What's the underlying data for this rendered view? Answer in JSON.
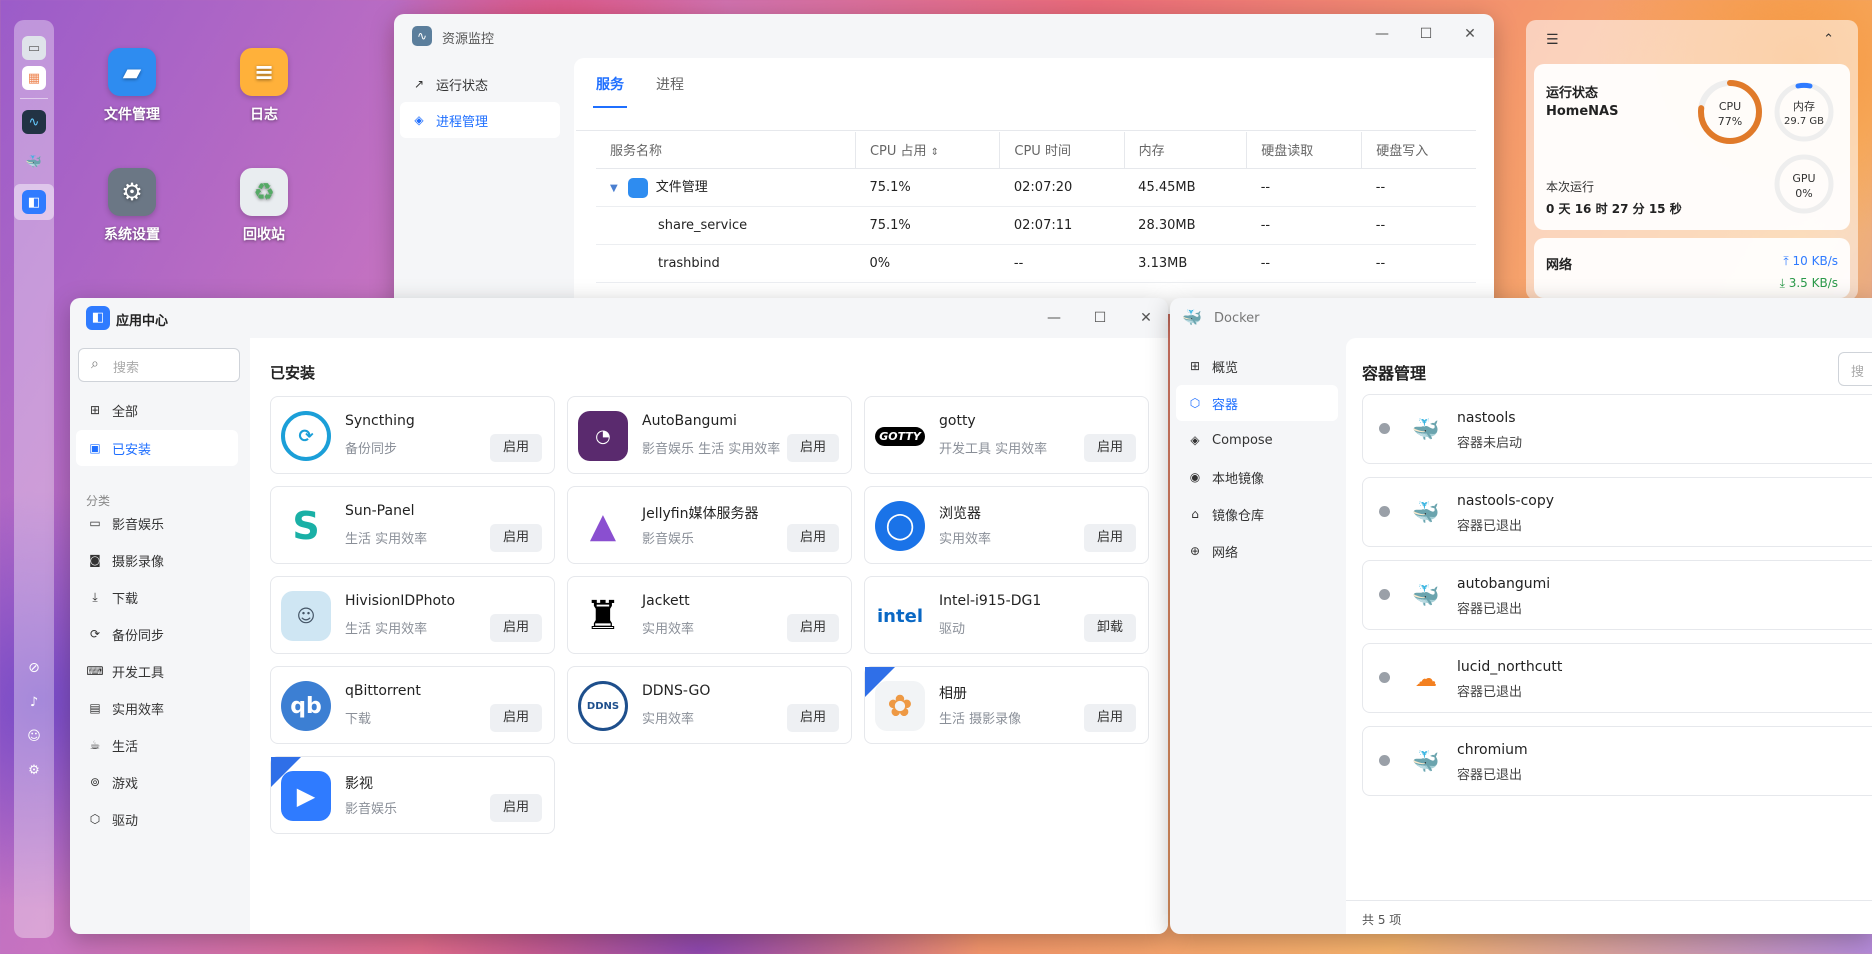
{
  "desktop": {
    "icons": [
      {
        "label": "文件管理"
      },
      {
        "label": "日志"
      },
      {
        "label": "系统设置"
      },
      {
        "label": "回收站"
      }
    ]
  },
  "resource_monitor": {
    "title": "资源监控",
    "sidebar": [
      "运行状态",
      "进程管理"
    ],
    "tabs": [
      "服务",
      "进程"
    ],
    "columns": [
      "服务名称",
      "CPU 占用",
      "CPU 时间",
      "内存",
      "硬盘读取",
      "硬盘写入"
    ],
    "rows": [
      {
        "name": "文件管理",
        "cpu": "75.1%",
        "cpu_time": "02:07:20",
        "mem": "45.45MB",
        "read": "--",
        "write": "--"
      },
      {
        "name": "share_service",
        "cpu": "75.1%",
        "cpu_time": "02:07:11",
        "mem": "28.30MB",
        "read": "--",
        "write": "--"
      },
      {
        "name": "trashbind",
        "cpu": "0%",
        "cpu_time": "--",
        "mem": "3.13MB",
        "read": "--",
        "write": "--"
      }
    ]
  },
  "status_panel": {
    "title": "运行状态",
    "host": "HomeNAS",
    "cpu_label": "CPU",
    "cpu_value": "77%",
    "mem_label": "内存",
    "mem_value": "29.7 GB",
    "gpu_label": "GPU",
    "gpu_value": "0%",
    "uptime_label": "本次运行",
    "uptime_value": "0 天 16 时 27 分 15 秒",
    "network_label": "网络",
    "net_up": "10 KB/s",
    "net_down": "3.5 KB/s",
    "cpu_fraction": 0.77
  },
  "app_center": {
    "title": "应用中心",
    "search_placeholder": "搜索",
    "nav": [
      "全部",
      "已安装"
    ],
    "category_label": "分类",
    "categories": [
      "影音娱乐",
      "摄影录像",
      "下载",
      "备份同步",
      "开发工具",
      "实用效率",
      "生活",
      "游戏",
      "驱动"
    ],
    "section_title": "已安装",
    "apps": [
      {
        "name": "Syncthing",
        "tags": "备份同步",
        "action": "启用"
      },
      {
        "name": "AutoBangumi",
        "tags": "影音娱乐 生活 实用效率",
        "action": "启用"
      },
      {
        "name": "gotty",
        "tags": "开发工具 实用效率",
        "action": "启用"
      },
      {
        "name": "Sun-Panel",
        "tags": "生活 实用效率",
        "action": "启用"
      },
      {
        "name": "Jellyfin媒体服务器",
        "tags": "影音娱乐",
        "action": "启用"
      },
      {
        "name": "浏览器",
        "tags": "实用效率",
        "action": "启用"
      },
      {
        "name": "HivisionIDPhoto",
        "tags": "生活 实用效率",
        "action": "启用"
      },
      {
        "name": "Jackett",
        "tags": "实用效率",
        "action": "启用"
      },
      {
        "name": "Intel-i915-DG1",
        "tags": "驱动",
        "action": "卸载"
      },
      {
        "name": "qBittorrent",
        "tags": "下载",
        "action": "启用"
      },
      {
        "name": "DDNS-GO",
        "tags": "实用效率",
        "action": "启用"
      },
      {
        "name": "相册",
        "tags": "生活 摄影录像",
        "action": "启用"
      },
      {
        "name": "影视",
        "tags": "影音娱乐",
        "action": "启用"
      }
    ],
    "logo_text": {
      "gotty": "GOTTY",
      "intel": "intel",
      "qb": "qb",
      "ddns": "DDNS"
    }
  },
  "docker": {
    "title": "Docker",
    "nav": [
      "概览",
      "容器",
      "Compose",
      "本地镜像",
      "镜像仓库",
      "网络"
    ],
    "section_title": "容器管理",
    "search_placeholder": "搜",
    "containers": [
      {
        "name": "nastools",
        "status": "容器未启动"
      },
      {
        "name": "nastools-copy",
        "status": "容器已退出"
      },
      {
        "name": "autobangumi",
        "status": "容器已退出"
      },
      {
        "name": "lucid_northcutt",
        "status": "容器已退出"
      },
      {
        "name": "chromium",
        "status": "容器已退出"
      }
    ],
    "footer": "共 5 项"
  }
}
